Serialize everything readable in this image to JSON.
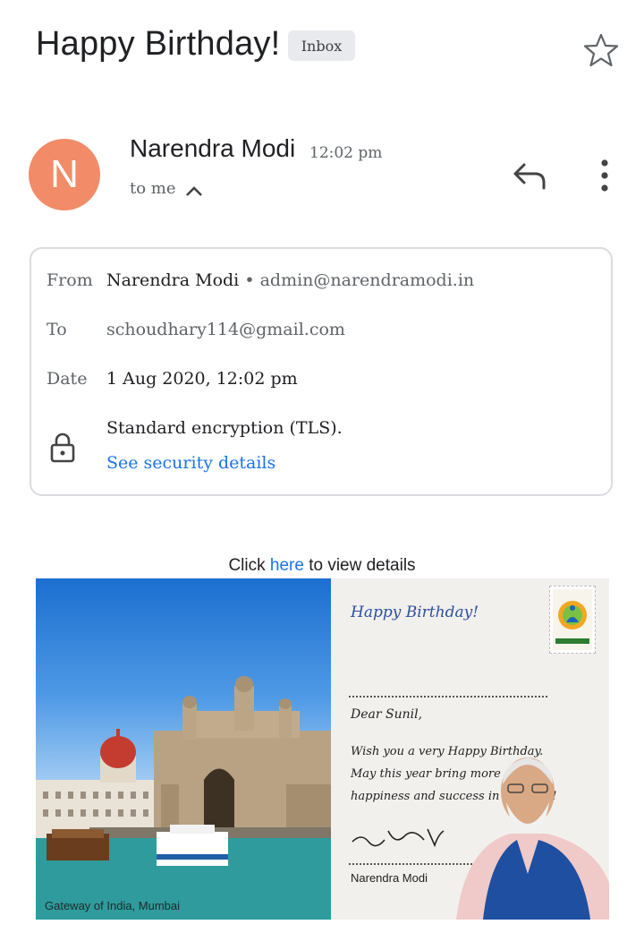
{
  "header": {
    "subject": "Happy Birthday!",
    "label_badge": "Inbox"
  },
  "message": {
    "avatar_letter": "N",
    "avatar_color": "#f28b67",
    "sender_name": "Narendra Modi",
    "time": "12:02 pm",
    "recipient_summary": "to me"
  },
  "details": {
    "from_label": "From",
    "from_name": "Narendra Modi",
    "from_separator": "•",
    "from_email": "admin@narendramodi.in",
    "to_label": "To",
    "to_value": "schoudhary114@gmail.com",
    "date_label": "Date",
    "date_value": "1 Aug 2020, 12:02 pm",
    "encryption_text": "Standard encryption (TLS).",
    "security_link": "See security details"
  },
  "body": {
    "click_prefix": "Click",
    "click_link": "here",
    "click_suffix": "to view details",
    "card": {
      "photo_caption": "Gateway of India, Mumbai",
      "greeting_title": "Happy Birthday!",
      "salutation": "Dear Sunil,",
      "message_lines": [
        "Wish you a very Happy Birthday.",
        "May this year bring more",
        "happiness and success in your life!"
      ],
      "signature_name": "Narendra Modi"
    }
  },
  "colors": {
    "link": "#1a73e8",
    "badge_bg": "#e8eaed",
    "border": "#dadce0"
  }
}
